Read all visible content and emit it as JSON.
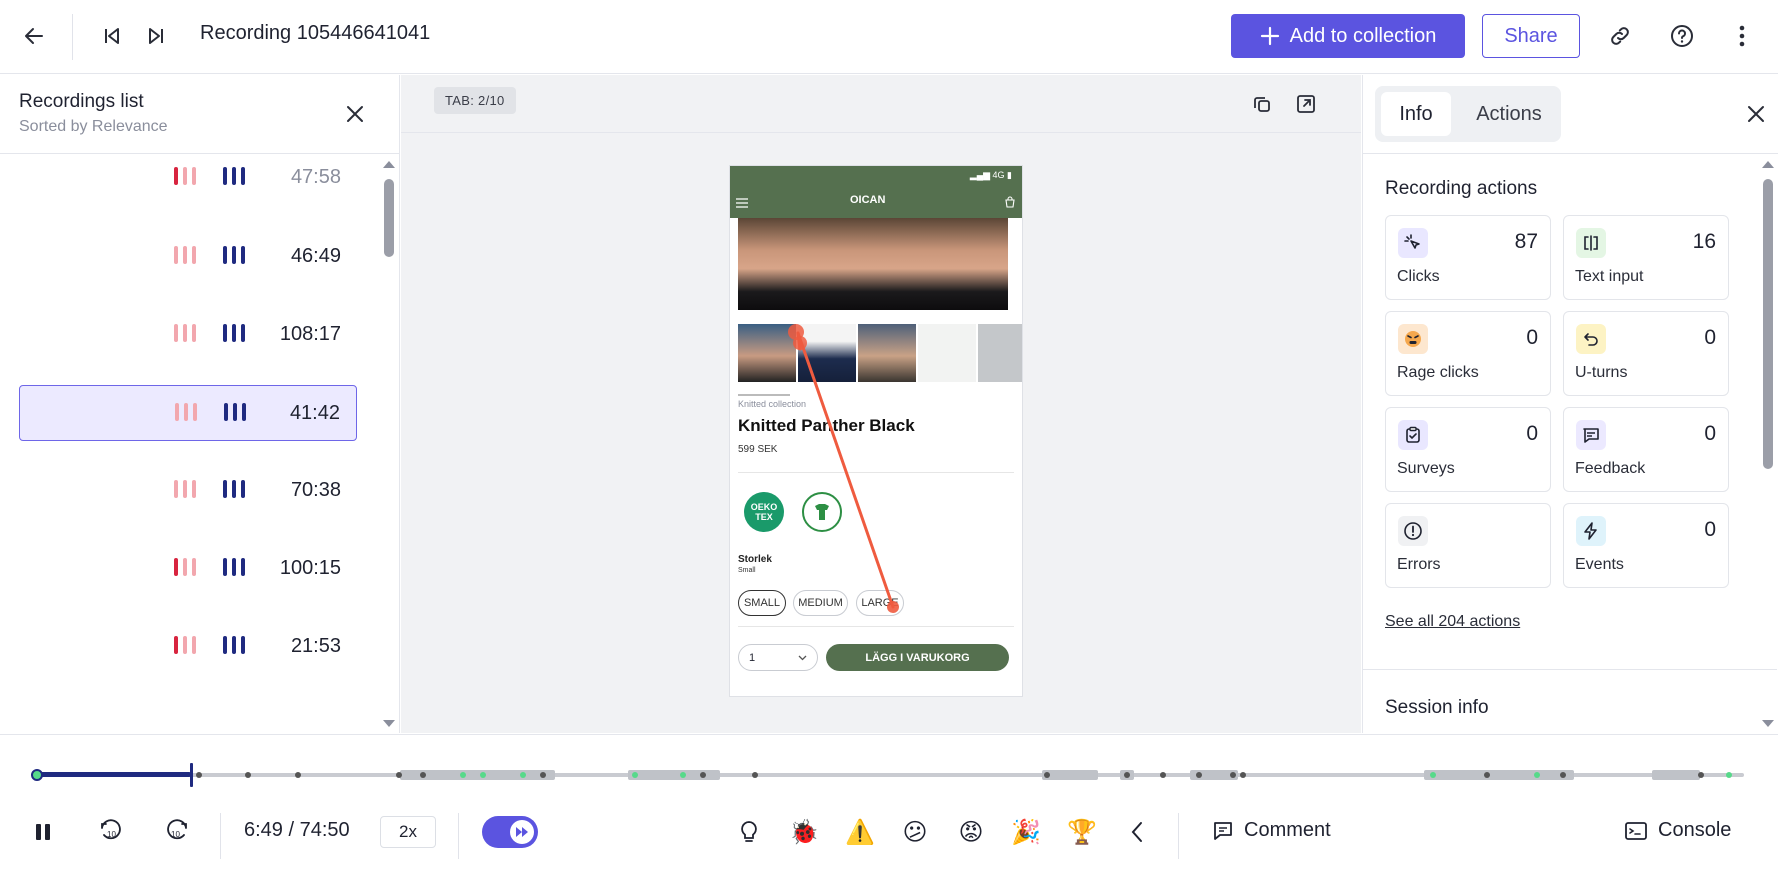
{
  "header": {
    "title": "Recording 105446641041",
    "add_label": "Add to collection",
    "share_label": "Share"
  },
  "recordings": {
    "title": "Recordings list",
    "subtitle": "Sorted by Relevance",
    "items": [
      {
        "time": "47:58",
        "muted": true
      },
      {
        "time": "46:49",
        "muted": false
      },
      {
        "time": "108:17",
        "muted": false
      },
      {
        "time": "41:42",
        "muted": false,
        "selected": true
      },
      {
        "time": "70:38",
        "muted": false
      },
      {
        "time": "100:15",
        "muted": false
      },
      {
        "time": "21:53",
        "muted": false
      }
    ]
  },
  "player": {
    "tab_badge": "TAB: 2/10",
    "product": {
      "brand": "OICAN",
      "collection": "Knitted collection",
      "name": "Knitted Panther Black",
      "price": "599 SEK",
      "size_label": "Storlek",
      "size_value": "Small",
      "sizes": [
        "SMALL",
        "MEDIUM",
        "LARGE"
      ],
      "qty": "1",
      "cart_label": "LÄGG I VARUKORG",
      "oeko": "OEKO TEX"
    }
  },
  "info_panel": {
    "tabs": [
      "Info",
      "Actions"
    ],
    "section_title": "Recording actions",
    "cards": [
      {
        "label": "Clicks",
        "value": "87",
        "icon": "cursor-click-icon",
        "bg": "#e9e7ff"
      },
      {
        "label": "Text input",
        "value": "16",
        "icon": "text-input-icon",
        "bg": "#e4f6e4"
      },
      {
        "label": "Rage clicks",
        "value": "0",
        "icon": "rage-face-icon",
        "bg": "#fde7cf"
      },
      {
        "label": "U-turns",
        "value": "0",
        "icon": "u-turn-icon",
        "bg": "#fdf3c4"
      },
      {
        "label": "Surveys",
        "value": "0",
        "icon": "clipboard-check-icon",
        "bg": "#e9e7ff"
      },
      {
        "label": "Feedback",
        "value": "0",
        "icon": "feedback-icon",
        "bg": "#ece9ff"
      },
      {
        "label": "Errors",
        "value": "",
        "icon": "error-icon",
        "bg": "#f0f1f3"
      },
      {
        "label": "Events",
        "value": "0",
        "icon": "lightning-icon",
        "bg": "#dff3fb"
      }
    ],
    "see_all": "See all 204 actions",
    "session_title": "Session info"
  },
  "controls": {
    "time": "6:49 / 74:50",
    "speed": "2x",
    "comment_label": "Comment",
    "console_label": "Console",
    "progress": 0.091
  }
}
